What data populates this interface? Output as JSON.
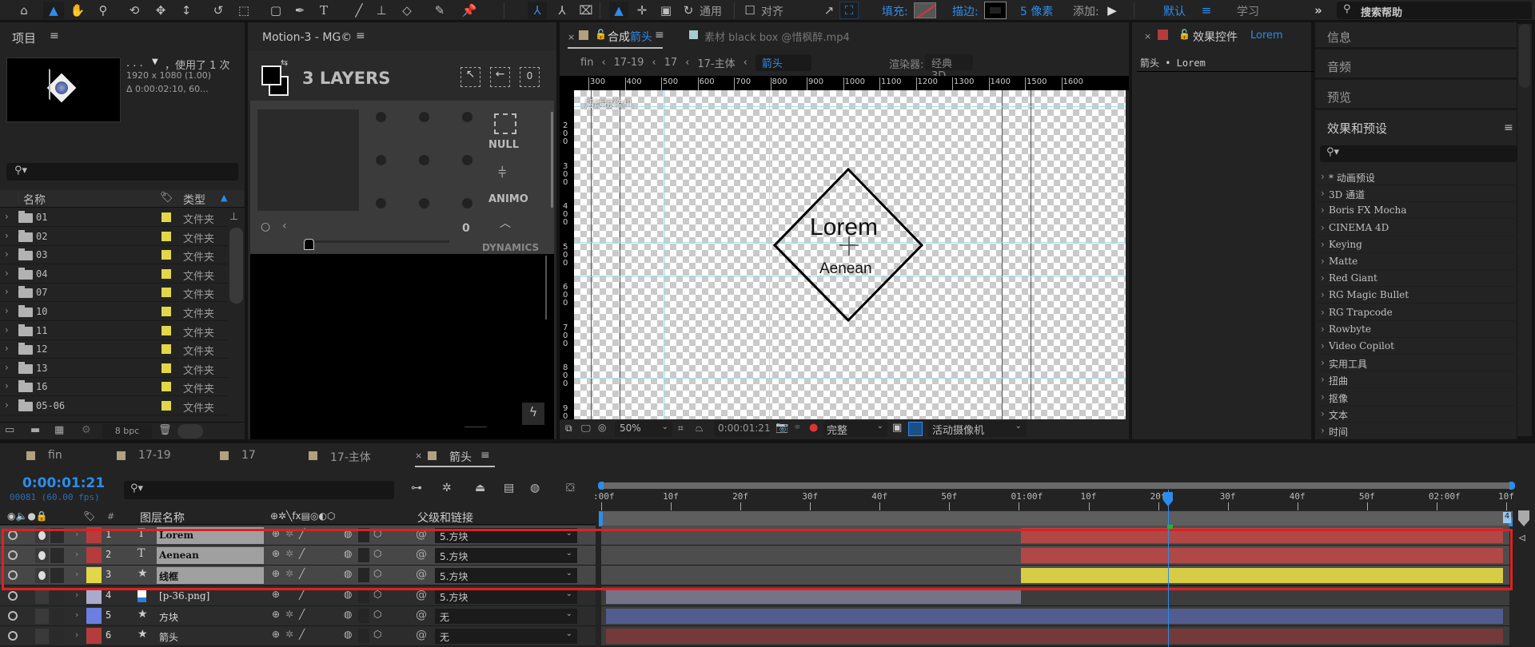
{
  "toolbar": {
    "tools": [
      "home-icon",
      "selection-icon",
      "hand-icon",
      "zoom-icon",
      "rotate-orbit-icon",
      "pan-behind-icon",
      "dolly-icon",
      "rotation-icon",
      "anchor-icon",
      "rectangle-icon",
      "pen-icon",
      "text-icon",
      "brush-icon",
      "clone-stamp-icon",
      "eraser-icon",
      "roto-brush-icon",
      "puppet-pin-icon"
    ],
    "general_label": "通用",
    "align_label": "对齐",
    "fill_label": "填充:",
    "stroke_label": "描边:",
    "stroke_width": "5 像素",
    "add_label": "添加:",
    "workspace_default": "默认",
    "workspace_learn": "学习",
    "search_placeholder": "搜索帮助"
  },
  "project": {
    "title": "项目",
    "thumb_name": ". . .",
    "used": "，使用了 1 次",
    "dimensions": "1920 x 1080 (1.00)",
    "duration": "Δ 0:00:02:10, 60...",
    "col_name": "名称",
    "col_type": "类型",
    "items": [
      {
        "name": "01",
        "type": "文件夹"
      },
      {
        "name": "02",
        "type": "文件夹"
      },
      {
        "name": "03",
        "type": "文件夹"
      },
      {
        "name": "04",
        "type": "文件夹"
      },
      {
        "name": "07",
        "type": "文件夹"
      },
      {
        "name": "10",
        "type": "文件夹"
      },
      {
        "name": "11",
        "type": "文件夹"
      },
      {
        "name": "12",
        "type": "文件夹"
      },
      {
        "name": "13",
        "type": "文件夹"
      },
      {
        "name": "16",
        "type": "文件夹"
      },
      {
        "name": "05-06",
        "type": "文件夹"
      }
    ],
    "bpc": "8 bpc"
  },
  "motion": {
    "title": "Motion-3 - MG©",
    "layers_count": "3 LAYERS",
    "null_label": "NULL",
    "animo_label": "ANIMO",
    "dynamics_label": "DYNAMICS",
    "slider_value": "0",
    "slider_fraction": 0.0
  },
  "composition": {
    "tab_prefix": "合成",
    "tab_name": "箭头",
    "footage_tab": "素材 black box @惜枫醉.mp4",
    "breadcrumbs": [
      "fin",
      "17-19",
      "17",
      "17-主体",
      "箭头"
    ],
    "renderer_label": "渲染器:",
    "renderer_value": "经典 3D",
    "ruler_h": [
      "300",
      "400",
      "500",
      "600",
      "700",
      "800",
      "900",
      "1000",
      "1100",
      "1200",
      "1300",
      "1400",
      "1500",
      "1600"
    ],
    "ruler_v": [
      "200",
      "300",
      "400",
      "500",
      "600",
      "700",
      "800",
      "900"
    ],
    "camera_overlay": "活动摄像机",
    "canvas_text_main": "Lorem",
    "canvas_text_sub": "Aenean",
    "zoom": "50%",
    "timecode": "0:00:01:21",
    "resolution": "完整",
    "camera": "活动摄像机"
  },
  "effects_controls": {
    "title": "效果控件",
    "layer": "Lorem",
    "breadcrumb": "箭头 • Lorem"
  },
  "right_panels": {
    "info": "信息",
    "audio": "音频",
    "preview": "预览",
    "effects_presets": "效果和预设",
    "effects": [
      "* 动画预设",
      "3D 通道",
      "Boris FX Mocha",
      "CINEMA 4D",
      "Keying",
      "Matte",
      "Red Giant",
      "RG Magic Bullet",
      "RG Trapcode",
      "Rowbyte",
      "Video Copilot",
      "实用工具",
      "扭曲",
      "抠像",
      "文本",
      "时间"
    ]
  },
  "timeline": {
    "tabs": [
      {
        "label": "fin",
        "color": "#b3a07e"
      },
      {
        "label": "17-19",
        "color": "#b3a07e"
      },
      {
        "label": "17",
        "color": "#b3a07e"
      },
      {
        "label": "17-主体",
        "color": "#b3a07e"
      },
      {
        "label": "箭头",
        "color": "#b3a07e",
        "active": true
      }
    ],
    "timecode": "0:00:01:21",
    "frames": "00081 (60.00 fps)",
    "col_layer_name": "图层名称",
    "col_parent": "父级和链接",
    "col_hash": "#",
    "ruler": [
      ":00f",
      "10f",
      "20f",
      "30f",
      "40f",
      "50f",
      "01:00f",
      "10f",
      "20f",
      "30f",
      "40f",
      "50f",
      "02:00f",
      "10f"
    ],
    "end_marker": "4",
    "playhead_fraction": 0.624,
    "layers": [
      {
        "num": "1",
        "type": "T",
        "name": "Lorem",
        "color": "#b53c3c",
        "parent": "5.方块",
        "selected": true,
        "bar_color": "#b04848",
        "start": 0.463,
        "end": 1.0
      },
      {
        "num": "2",
        "type": "T",
        "name": "Aenean",
        "color": "#b53c3c",
        "parent": "5.方块",
        "selected": true,
        "bar_color": "#b04848",
        "start": 0.463,
        "end": 1.0
      },
      {
        "num": "3",
        "type": "★",
        "name": "线框",
        "color": "#e2d649",
        "parent": "5.方块",
        "selected": true,
        "bar_color": "#d6cc45",
        "start": 0.463,
        "end": 1.0
      },
      {
        "num": "4",
        "type": "img",
        "name": "[p-36.png]",
        "color": "#aaaacc",
        "parent": "5.方块",
        "selected": false,
        "bar_color": "#747388",
        "start": 0.0,
        "end": 0.463
      },
      {
        "num": "5",
        "type": "★",
        "name": "方块",
        "color": "#6a7fe0",
        "parent": "无",
        "selected": false,
        "bar_color": "#525c8e",
        "start": 0.0,
        "end": 1.0
      },
      {
        "num": "6",
        "type": "★",
        "name": "箭头",
        "color": "#b53c3c",
        "parent": "无",
        "selected": false,
        "bar_color": "#743a3a",
        "start": 0.0,
        "end": 1.0
      }
    ]
  },
  "colors": {
    "accent": "#2d8ceb",
    "selection_outline": "#e02020"
  }
}
